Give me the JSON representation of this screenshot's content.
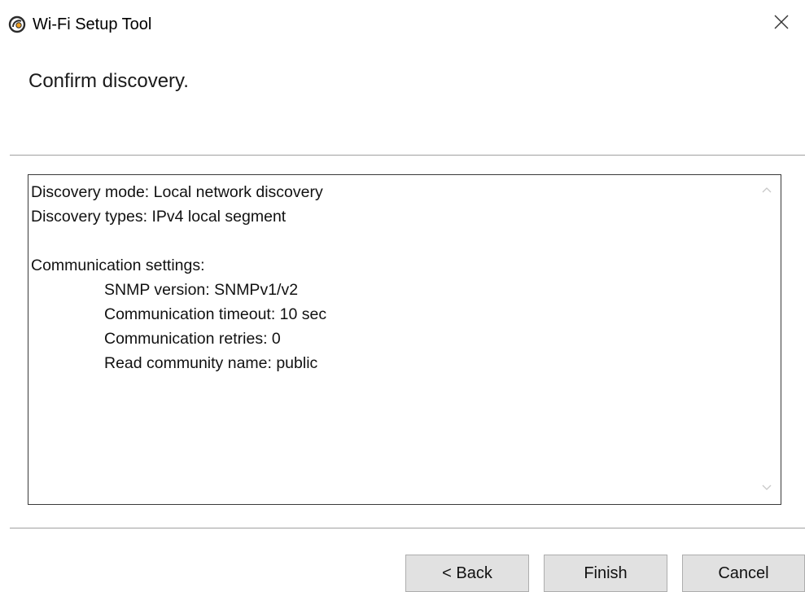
{
  "window": {
    "title": "Wi-Fi Setup Tool",
    "app_icon": "wifi-setup-app-icon",
    "close_icon": "close-icon"
  },
  "header": {
    "title": "Confirm discovery."
  },
  "summary": {
    "lines": [
      "Discovery mode: Local network discovery",
      "Discovery types: IPv4 local segment",
      "",
      "Communication settings:",
      "SNMP version: SNMPv1/v2",
      "Communication timeout: 10 sec",
      "Communication retries: 0",
      "Read community name: public"
    ],
    "scroll_up_icon": "chevron-up-icon",
    "scroll_down_icon": "chevron-down-icon"
  },
  "buttons": {
    "back": "< Back",
    "finish": "Finish",
    "cancel": "Cancel"
  }
}
